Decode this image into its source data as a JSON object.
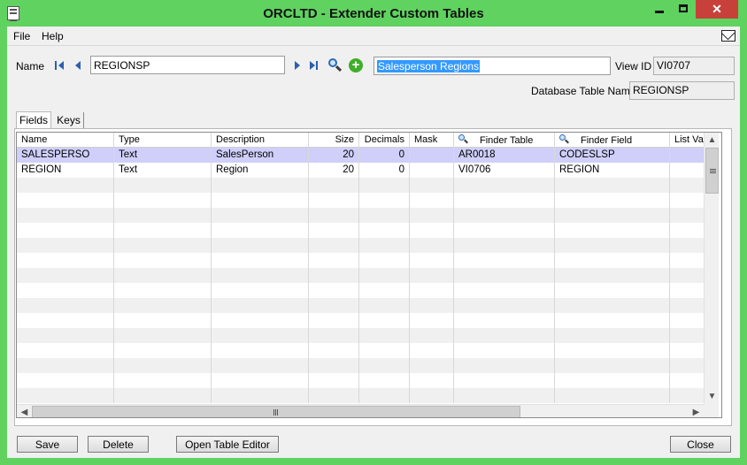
{
  "window": {
    "title": "ORCLTD - Extender Custom Tables",
    "minimize": "minimize",
    "maximize": "maximize",
    "close_glyph": "✕"
  },
  "menu": {
    "file": "File",
    "help": "Help"
  },
  "form": {
    "name_label": "Name",
    "name_value": "REGIONSP",
    "description_value": "Salesperson Regions",
    "view_id_label": "View ID",
    "view_id_value": "VI0707",
    "db_table_label": "Database Table Name",
    "db_table_value": "REGIONSP"
  },
  "tabs": [
    {
      "label": "Fields",
      "active": true
    },
    {
      "label": "Keys",
      "active": false
    }
  ],
  "grid": {
    "columns": [
      "Name",
      "Type",
      "Description",
      "Size",
      "Decimals",
      "Mask",
      "Finder Table",
      "Finder Field",
      "List Va"
    ],
    "rows": [
      {
        "name": "SALESPERSO",
        "type": "Text",
        "description": "SalesPerson",
        "size": "20",
        "decimals": "0",
        "mask": "",
        "finder_table": "AR0018",
        "finder_field": "CODESLSP",
        "list_values": ""
      },
      {
        "name": "REGION",
        "type": "Text",
        "description": "Region",
        "size": "20",
        "decimals": "0",
        "mask": "",
        "finder_table": "VI0706",
        "finder_field": "REGION",
        "list_values": ""
      }
    ],
    "selected_row": 0
  },
  "buttons": {
    "save": "Save",
    "delete": "Delete",
    "open_editor": "Open Table Editor",
    "close": "Close"
  },
  "icons": {
    "first": "first-record-icon",
    "previous": "previous-record-icon",
    "next": "next-record-icon",
    "last": "last-record-icon",
    "finder": "search-icon",
    "new": "add-icon",
    "mail": "mail-icon"
  },
  "colors": {
    "title_bar": "#5fd25f",
    "close_button": "#c7413a",
    "selection": "#3399ff",
    "selected_row": "#cfcffa"
  }
}
